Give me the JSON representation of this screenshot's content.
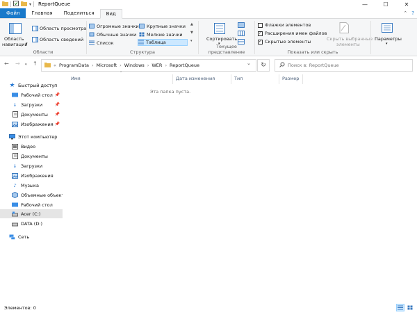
{
  "window": {
    "title": "ReportQueue",
    "controls": [
      "minimize-icon",
      "maximize-icon",
      "close-icon"
    ]
  },
  "tabs": [
    {
      "label": "Файл"
    },
    {
      "label": "Главная"
    },
    {
      "label": "Поделиться"
    },
    {
      "label": "Вид"
    }
  ],
  "ribbon": {
    "panes": {
      "nav_pane_line1": "Область",
      "nav_pane_line2": "навигации",
      "preview": "Область просмотра",
      "details": "Область сведений",
      "label": "Области"
    },
    "layout": {
      "items": [
        "Огромные значки",
        "Крупные значки",
        "Обычные значки",
        "Мелкие значки",
        "Список",
        "Таблица"
      ],
      "selected": "Таблица",
      "label": "Структура"
    },
    "current_view": {
      "sort": "Сортировать",
      "label": "Текущее представление"
    },
    "show_hide": {
      "item_checkboxes": "Флажки элементов",
      "extensions": "Расширения имен файлов",
      "hidden_items": "Скрытые элементы",
      "hide_selected_line1": "Скрыть выбранные",
      "hide_selected_line2": "элементы",
      "label": "Показать или скрыть"
    },
    "options": {
      "label": "Параметры"
    }
  },
  "address": {
    "overflow": "«",
    "crumbs": [
      "ProgramData",
      "Microsoft",
      "Windows",
      "WER",
      "ReportQueue"
    ]
  },
  "search": {
    "placeholder": "Поиск в: ReportQueue"
  },
  "nav": {
    "quick_access": "Быстрый доступ",
    "quick_items": [
      "Рабочий стол",
      "Загрузки",
      "Документы",
      "Изображения"
    ],
    "this_pc": "Этот компьютер",
    "pc_items": [
      "Видео",
      "Документы",
      "Загрузки",
      "Изображения",
      "Музыка",
      "Объемные объекты",
      "Рабочий стол",
      "Acer (C:)",
      "DATA (D:)"
    ],
    "selected": "Acer (C:)",
    "network": "Сеть"
  },
  "columns": [
    "Имя",
    "Дата изменения",
    "Тип",
    "Размер"
  ],
  "empty_message": "Эта папка пуста.",
  "status": {
    "items": "Элементов: 0"
  },
  "colors": {
    "accent": "#1979ca",
    "selection": "#cce8ff",
    "folder": "#e8b84a"
  }
}
